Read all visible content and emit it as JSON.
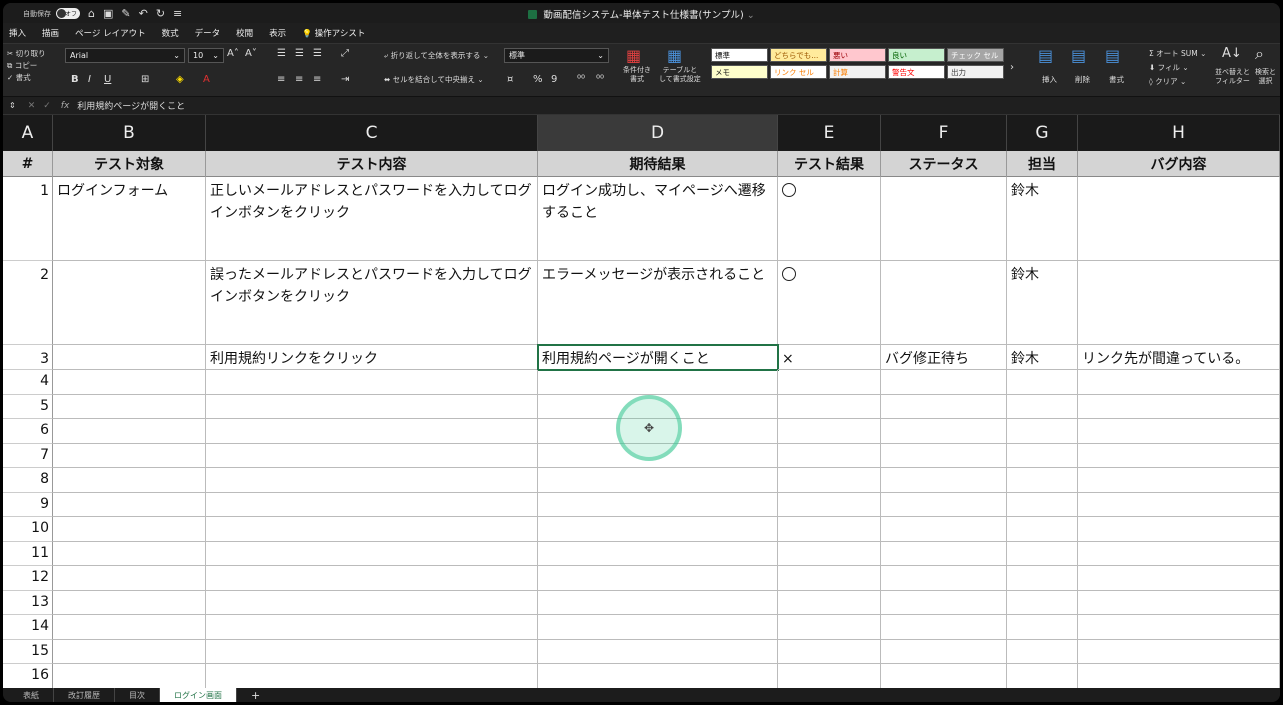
{
  "titlebar": {
    "autosave_label": "自動保存",
    "autosave_state": "オフ",
    "doc_title": "動画配信システム-単体テスト仕様書(サンプル)",
    "more_glyph": "⌄"
  },
  "menu": [
    "挿入",
    "描画",
    "ページ レイアウト",
    "数式",
    "データ",
    "校閲",
    "表示"
  ],
  "menu_assist": "操作アシスト",
  "ribbon": {
    "clipboard": [
      "切り取り",
      "コピー",
      "書式"
    ],
    "font_name": "Arial",
    "font_size": "10",
    "wrap_text": "折り返して全体を表示する",
    "merge_center": "セルを結合して中央揃え",
    "number_format": "標準",
    "cond_format": "条件付き\n書式",
    "table_format": "テーブルと\nして書式設定",
    "styles": [
      {
        "label": "標準",
        "bg": "#ffffff",
        "fg": "#111111"
      },
      {
        "label": "どちらでも...",
        "bg": "#ffeb9c",
        "fg": "#9c5700"
      },
      {
        "label": "悪い",
        "bg": "#ffc7ce",
        "fg": "#9c0006"
      },
      {
        "label": "良い",
        "bg": "#c6efce",
        "fg": "#006100"
      },
      {
        "label": "チェック セル",
        "bg": "#a5a5a5",
        "fg": "#ffffff"
      },
      {
        "label": "メモ",
        "bg": "#ffffcc",
        "fg": "#111111"
      },
      {
        "label": "リンク セル",
        "bg": "#ffffff",
        "fg": "#fa7d00"
      },
      {
        "label": "計算",
        "bg": "#f2f2f2",
        "fg": "#fa7d00"
      },
      {
        "label": "警告文",
        "bg": "#ffffff",
        "fg": "#ff0000"
      },
      {
        "label": "出力",
        "bg": "#f2f2f2",
        "fg": "#3f3f3f"
      }
    ],
    "insert": "挿入",
    "delete": "削除",
    "format": "書式",
    "autosum": "オート SUM",
    "fill": "フィル",
    "clear": "クリア",
    "sort_filter": "並べ替えと\nフィルター",
    "find_select": "検索と\n選択"
  },
  "formula_bar": {
    "fx": "fx",
    "content": "利用規約ページが開くこと"
  },
  "columns": [
    "A",
    "B",
    "C",
    "D",
    "E",
    "F",
    "G",
    "H"
  ],
  "active_column": "D",
  "header_row": [
    "#",
    "テスト対象",
    "テスト内容",
    "期待結果",
    "テスト結果",
    "ステータス",
    "担当",
    "バグ内容"
  ],
  "rows": [
    {
      "no": "1",
      "target": "ログインフォーム",
      "content": "正しいメールアドレスとパスワードを入力してログインボタンをクリック",
      "expected": "ログイン成功し、マイページへ遷移すること",
      "result": "○",
      "status": "",
      "owner": "鈴木",
      "bug": ""
    },
    {
      "no": "2",
      "target": "",
      "content": "誤ったメールアドレスとパスワードを入力してログインボタンをクリック",
      "expected": "エラーメッセージが表示されること",
      "result": "○",
      "status": "",
      "owner": "鈴木",
      "bug": ""
    },
    {
      "no": "3",
      "target": "",
      "content": "利用規約リンクをクリック",
      "expected": "利用規約ページが開くこと",
      "result": "×",
      "status": "バグ修正待ち",
      "owner": "鈴木",
      "bug": "リンク先が間違っている。"
    }
  ],
  "empty_rows": [
    "4",
    "5",
    "6",
    "7",
    "8",
    "9",
    "10",
    "11",
    "12",
    "13",
    "14",
    "15",
    "16"
  ],
  "sheet_tabs": [
    "表紙",
    "改訂履歴",
    "目次",
    "ログイン画面"
  ],
  "active_tab": "ログイン画面",
  "add_tab": "+"
}
